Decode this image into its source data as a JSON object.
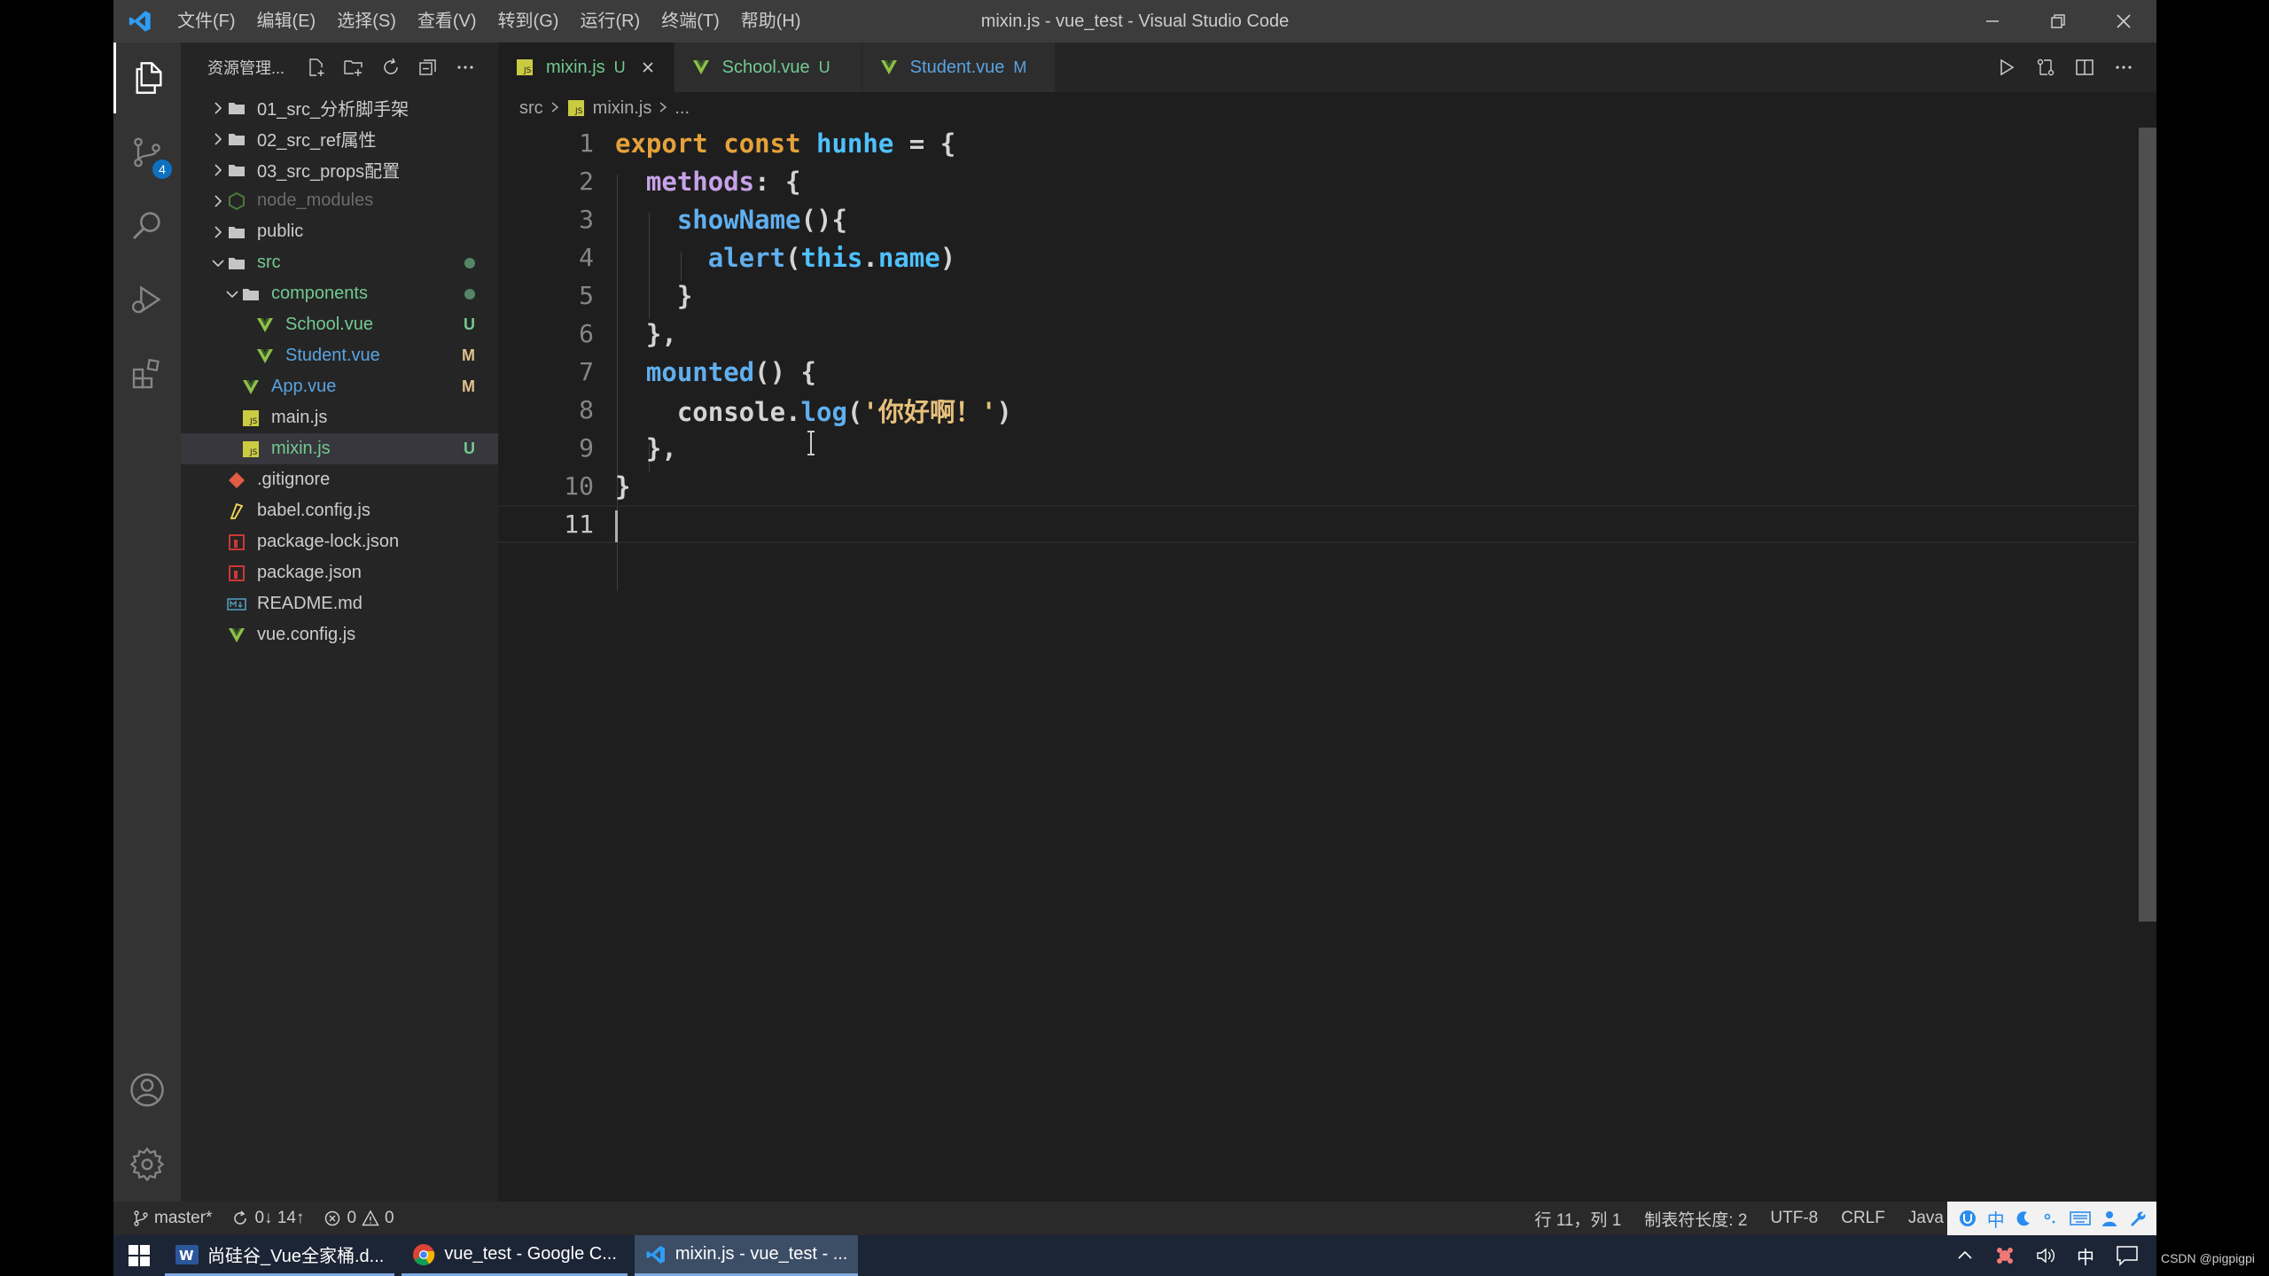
{
  "window": {
    "title": "mixin.js - vue_test - Visual Studio Code",
    "menu": [
      "文件(F)",
      "编辑(E)",
      "选择(S)",
      "查看(V)",
      "转到(G)",
      "运行(R)",
      "终端(T)",
      "帮助(H)"
    ]
  },
  "activity": {
    "scm_badge": "4"
  },
  "sidebar": {
    "title": "资源管理...",
    "items": [
      {
        "label": "01_src_分析脚手架",
        "type": "folder"
      },
      {
        "label": "02_src_ref属性",
        "type": "folder"
      },
      {
        "label": "03_src_props配置",
        "type": "folder"
      },
      {
        "label": "node_modules",
        "type": "folder"
      },
      {
        "label": "public",
        "type": "folder"
      },
      {
        "label": "src",
        "type": "folder-open"
      },
      {
        "label": "components",
        "type": "folder-open"
      },
      {
        "label": "School.vue",
        "status": "U"
      },
      {
        "label": "Student.vue",
        "status": "M"
      },
      {
        "label": "App.vue",
        "status": "M"
      },
      {
        "label": "main.js"
      },
      {
        "label": "mixin.js",
        "status": "U"
      },
      {
        "label": ".gitignore"
      },
      {
        "label": "babel.config.js"
      },
      {
        "label": "package-lock.json"
      },
      {
        "label": "package.json"
      },
      {
        "label": "README.md"
      },
      {
        "label": "vue.config.js"
      }
    ]
  },
  "tabs": [
    {
      "label": "mixin.js",
      "status": "U"
    },
    {
      "label": "School.vue",
      "status": "U"
    },
    {
      "label": "Student.vue",
      "status": "M"
    }
  ],
  "breadcrumb": {
    "folder": "src",
    "file": "mixin.js",
    "more": "..."
  },
  "editor": {
    "line_numbers": [
      "1",
      "2",
      "3",
      "4",
      "5",
      "6",
      "7",
      "8",
      "9",
      "10",
      "11"
    ],
    "tokens": {
      "export": "export",
      "const": "const",
      "hunhe": "hunhe",
      "eq_brace": " = {",
      "methods": "methods",
      "colon_brace": ": {",
      "showName": "showName",
      "paren_brace": "(){",
      "alert": "alert",
      "lparen": "(",
      "this": "this",
      "dot": ".",
      "name": "name",
      "rparen": ")",
      "close": "}",
      "close_comma": "},",
      "mounted": "mounted",
      "paren_space_brace": "() {",
      "console": "console",
      "log": "log",
      "string": "'你好啊！'"
    }
  },
  "statusbar": {
    "branch": "master*",
    "sync": "0↓ 14↑",
    "errors": "0",
    "warnings": "0",
    "position": "行 11，列 1",
    "tab_size": "制表符长度: 2",
    "encoding": "UTF-8",
    "eol": "CRLF",
    "language": "Java",
    "ime_lang": "中"
  },
  "taskbar": {
    "apps": [
      {
        "label": "尚硅谷_Vue全家桶.d..."
      },
      {
        "label": "vue_test - Google C..."
      },
      {
        "label": "mixin.js - vue_test - ..."
      }
    ],
    "tray_lang": "中",
    "watermark": "CSDN @pigpigpi"
  },
  "colors": {
    "accent": "#0e70c0",
    "keyword": "#e5a13a",
    "variable": "#4fc1ff",
    "function": "#61afef",
    "property": "#c7a2e8",
    "string": "#e6c07b",
    "git_untracked": "#73c991",
    "git_modified": "#e2c08d"
  }
}
